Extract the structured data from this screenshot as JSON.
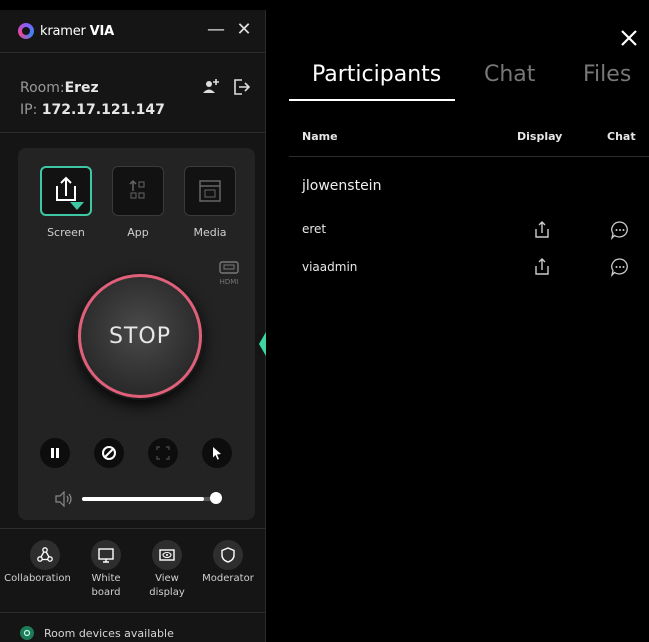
{
  "app": {
    "logo_brand": "kramer",
    "logo_product": "VIA"
  },
  "window": {
    "minimize": "—",
    "close": "✕"
  },
  "room": {
    "room_label": "Room:",
    "room_value": "Erez",
    "ip_label": "IP:",
    "ip_value": "172.17.121.147"
  },
  "sources": [
    {
      "label": "Screen",
      "icon": "share-screen-icon",
      "active": true
    },
    {
      "label": "App",
      "icon": "app-icon",
      "active": false
    },
    {
      "label": "Media",
      "icon": "media-icon",
      "active": false
    }
  ],
  "hdmi_label": "HDMI",
  "stop_label": "STOP",
  "controls": [
    "pause-icon",
    "block-icon",
    "fullscreen-icon",
    "pointer-icon"
  ],
  "volume": {
    "level": 0.9
  },
  "features": [
    {
      "label": "Collaboration",
      "icon": "collaboration-icon"
    },
    {
      "label": "White board",
      "icon": "whiteboard-icon"
    },
    {
      "label": "View display",
      "icon": "view-display-icon"
    },
    {
      "label": "Moderator",
      "icon": "moderator-icon"
    }
  ],
  "status_text": "Room devices available",
  "tabs": [
    "Participants",
    "Chat",
    "Files"
  ],
  "table": {
    "headers": {
      "name": "Name",
      "display": "Display",
      "chat": "Chat"
    },
    "group": "jlowenstein",
    "rows": [
      {
        "name": "eret"
      },
      {
        "name": "viaadmin"
      }
    ]
  },
  "colors": {
    "accent": "#3fc7a4",
    "stop_ring": "#e0607a",
    "panel_bg": "#151515",
    "card_bg": "#232323"
  }
}
